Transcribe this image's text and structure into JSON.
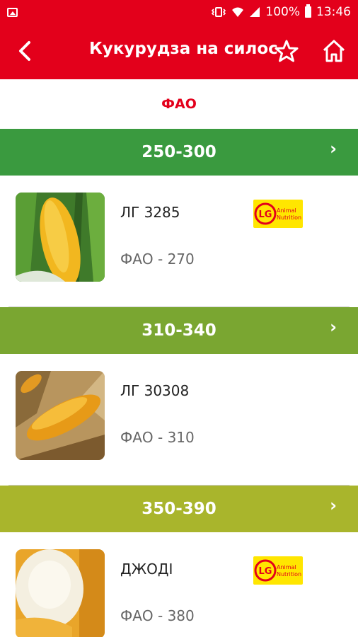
{
  "status_bar": {
    "battery_text": "100%",
    "time": "13:46"
  },
  "app_bar": {
    "title": "Кукурудза на силос"
  },
  "list_header": {
    "label": "ФАО"
  },
  "colors": {
    "brand_red": "#e3001b",
    "group1": "#3a9a3f",
    "group2": "#7aa631",
    "group3": "#a9b52c"
  },
  "groups": [
    {
      "label": "250-300",
      "item": {
        "name": "ЛГ 3285",
        "fao": "ФАО - 270",
        "logo": "LG Animal Nutrition"
      }
    },
    {
      "label": "310-340",
      "item": {
        "name": "ЛГ 30308",
        "fao": "ФАО - 310"
      }
    },
    {
      "label": "350-390",
      "item": {
        "name": "ДЖОДІ",
        "fao": "ФАО - 380",
        "logo": "LG Animal Nutrition"
      }
    }
  ]
}
